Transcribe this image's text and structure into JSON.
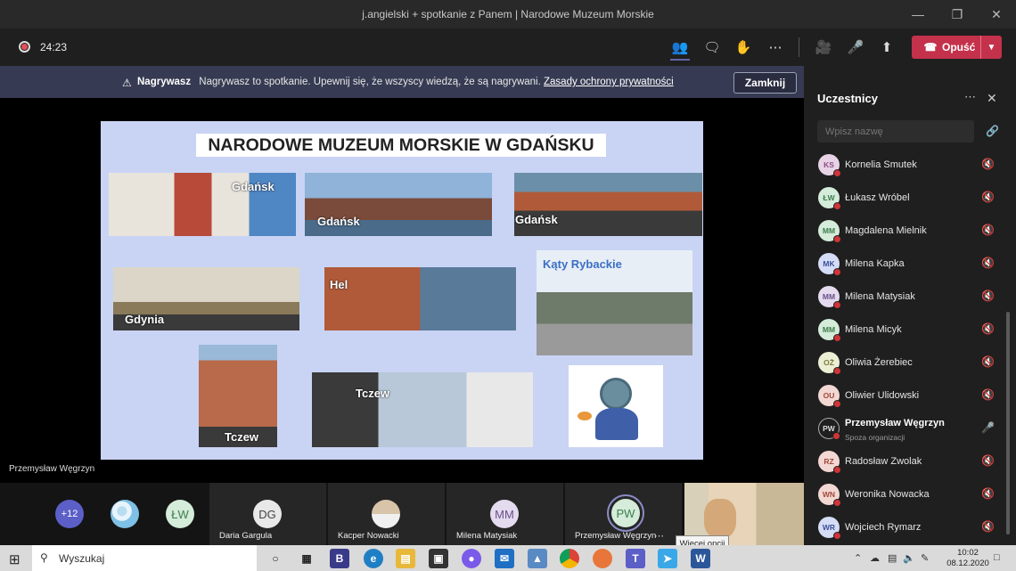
{
  "window": {
    "title": "j.angielski + spotkanie z Panem | Narodowe Muzeum Morskie"
  },
  "toolbar": {
    "timer": "24:23",
    "leave_label": "Opuść"
  },
  "banner": {
    "bold": "Nagrywasz",
    "text": "Nagrywasz to spotkanie. Upewnij się, że wszyscy wiedzą, że są nagrywani.",
    "link": "Zasady ochrony prywatności",
    "close": "Zamknij"
  },
  "slide": {
    "title": "NARODOWE MUZEUM MORSKIE W GDAŃSKU",
    "labels": [
      "Gdańsk",
      "Gdańsk",
      "Gdańsk",
      "Gdynia",
      "Hel",
      "Kąty Rybackie",
      "Tczew",
      "Tczew"
    ]
  },
  "speaker_name": "Przemysław Węgrzyn",
  "strip": {
    "overflow": "+12",
    "avatar_lw": "ŁW",
    "tiles": [
      {
        "initials": "DG",
        "name": "Daria Gargula"
      },
      {
        "name": "Kacper Nowacki"
      },
      {
        "initials": "MM",
        "name": "Milena Matysiak"
      },
      {
        "initials": "PW",
        "name": "Przemysław Węgrzyn"
      }
    ]
  },
  "tooltip": "Więcej opcji",
  "panel": {
    "title": "Uczestnicy",
    "search_placeholder": "Wpisz nazwę",
    "participants": [
      {
        "initials": "KS",
        "name": "Kornelia Smutek",
        "color": "#e8d3e6",
        "fg": "#8a4f86"
      },
      {
        "initials": "ŁW",
        "name": "Łukasz Wróbel",
        "color": "#d4ecd9",
        "fg": "#3f7d4e"
      },
      {
        "initials": "MM",
        "name": "Magdalena Mielnik",
        "color": "#d4ecd9",
        "fg": "#3f7d4e"
      },
      {
        "initials": "MK",
        "name": "Milena Kapka",
        "color": "#d5dcf5",
        "fg": "#3d4f9a"
      },
      {
        "initials": "MM",
        "name": "Milena Matysiak",
        "color": "#e4dbef",
        "fg": "#6b4f8a"
      },
      {
        "initials": "MM",
        "name": "Milena Micyk",
        "color": "#d4ecd9",
        "fg": "#3f7d4e"
      },
      {
        "initials": "OŻ",
        "name": "Oliwia Żerebiec",
        "color": "#ecefd4",
        "fg": "#7a7d3a"
      },
      {
        "initials": "OU",
        "name": "Oliwier Ulidowski",
        "color": "#f3d7d2",
        "fg": "#a04a3c"
      },
      {
        "initials": "PW",
        "name": "Przemysław Węgrzyn",
        "sub": "Spoza organizacji",
        "color": "#1f1f1f",
        "fg": "#ddd"
      },
      {
        "initials": "RZ",
        "name": "Radosław Zwolak",
        "color": "#f3d7d2",
        "fg": "#a04a3c"
      },
      {
        "initials": "WN",
        "name": "Weronika Nowacka",
        "color": "#f3d7d2",
        "fg": "#a04a3c"
      },
      {
        "initials": "WR",
        "name": "Wojciech Rymarz",
        "color": "#d5dcf5",
        "fg": "#3d4f9a"
      }
    ]
  },
  "taskbar": {
    "search": "Wyszukaj",
    "time": "10:02",
    "date": "08.12.2020"
  }
}
